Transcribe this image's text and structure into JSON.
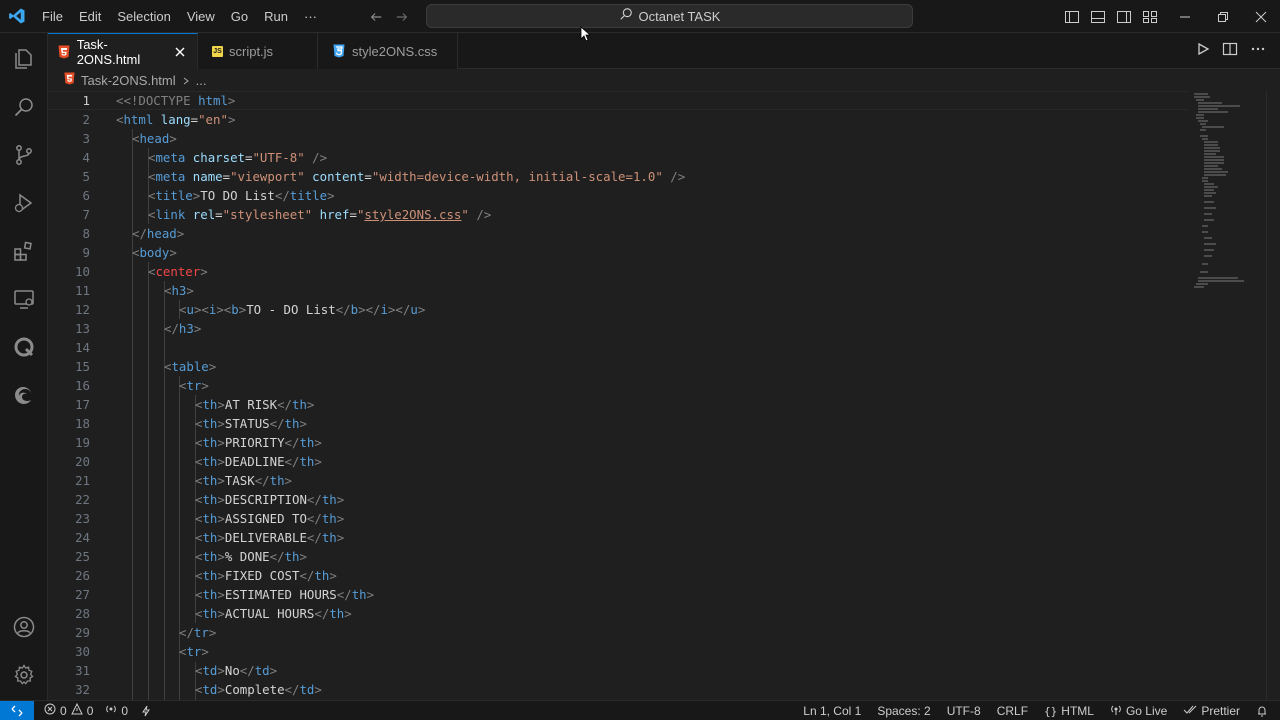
{
  "titlebar": {
    "menu": [
      "File",
      "Edit",
      "Selection",
      "View",
      "Go",
      "Run",
      "···"
    ],
    "search_text": "Octanet TASK"
  },
  "tabs": [
    {
      "label": "Task-2ONS.html",
      "icon": "html5-icon",
      "active": true
    },
    {
      "label": "script.js",
      "icon": "js-icon",
      "active": false
    },
    {
      "label": "style2ONS.css",
      "icon": "css-icon",
      "active": false
    }
  ],
  "breadcrumb": {
    "file": "Task-2ONS.html",
    "rest": "..."
  },
  "editor": {
    "lines": [
      {
        "n": "1",
        "current": true
      },
      {
        "n": "2"
      },
      {
        "n": "3"
      },
      {
        "n": "4"
      },
      {
        "n": "5"
      },
      {
        "n": "6"
      },
      {
        "n": "7"
      },
      {
        "n": "8"
      },
      {
        "n": "9"
      },
      {
        "n": "10"
      },
      {
        "n": "11"
      },
      {
        "n": "12"
      },
      {
        "n": "13"
      },
      {
        "n": "14"
      },
      {
        "n": "15"
      },
      {
        "n": "16"
      },
      {
        "n": "17"
      },
      {
        "n": "18"
      },
      {
        "n": "19"
      },
      {
        "n": "20"
      },
      {
        "n": "21"
      },
      {
        "n": "22"
      },
      {
        "n": "23"
      },
      {
        "n": "24"
      },
      {
        "n": "25"
      },
      {
        "n": "26"
      },
      {
        "n": "27"
      },
      {
        "n": "28"
      },
      {
        "n": "29"
      },
      {
        "n": "30"
      },
      {
        "n": "31"
      },
      {
        "n": "32"
      }
    ],
    "code": {
      "l1": [
        "<!DOCTYPE",
        " html",
        ">"
      ],
      "l2": [
        "<",
        "html",
        " lang",
        "=",
        "\"en\"",
        ">"
      ],
      "l3": [
        "<",
        "head",
        ">"
      ],
      "l4": [
        "<",
        "meta",
        " charset",
        "=",
        "\"UTF-8\"",
        " />"
      ],
      "l5": [
        "<",
        "meta",
        " name",
        "=",
        "\"viewport\"",
        " content",
        "=",
        "\"width=device-width, initial-scale=1.0\"",
        " />"
      ],
      "l6": [
        "<",
        "title",
        ">",
        "TO DO List",
        "</",
        "title",
        ">"
      ],
      "l7": [
        "<",
        "link",
        " rel",
        "=",
        "\"stylesheet\"",
        " href",
        "=",
        "\"",
        "style2ONS.css",
        "\"",
        " />"
      ],
      "l8": [
        "</",
        "head",
        ">"
      ],
      "l9": [
        "<",
        "body",
        ">"
      ],
      "l10": [
        "<",
        "center",
        ">"
      ],
      "l11": [
        "<",
        "h3",
        ">"
      ],
      "l12": [
        "<",
        "u",
        "><",
        "i",
        "><",
        "b",
        ">",
        "TO - DO List",
        "</",
        "b",
        "></",
        "i",
        "></",
        "u",
        ">"
      ],
      "l13": [
        "</",
        "h3",
        ">"
      ],
      "l15": [
        "<",
        "table",
        ">"
      ],
      "l16": [
        "<",
        "tr",
        ">"
      ],
      "th": [
        "AT RISK",
        "STATUS",
        "PRIORITY",
        "DEADLINE",
        "TASK",
        "DESCRIPTION",
        "ASSIGNED TO",
        "DELIVERABLE",
        "% DONE",
        "FIXED COST",
        "ESTIMATED HOURS",
        "ACTUAL HOURS"
      ],
      "l29": [
        "</",
        "tr",
        ">"
      ],
      "l30": [
        "<",
        "tr",
        ">"
      ],
      "td": [
        "No",
        "Complete"
      ]
    }
  },
  "statusbar": {
    "errors": "0",
    "warnings": "0",
    "ports": "0",
    "position": "Ln 1, Col 1",
    "spaces": "Spaces: 2",
    "encoding": "UTF-8",
    "eol": "CRLF",
    "language": "HTML",
    "golive": "Go Live",
    "prettier": "Prettier"
  },
  "colors": {
    "accent": "#0078d4",
    "tag": "#569cd6",
    "attr": "#9cdcfe",
    "string": "#ce9178",
    "html_icon": "#e44d26",
    "js_icon": "#f1d64a",
    "css_icon": "#42a5f5"
  }
}
